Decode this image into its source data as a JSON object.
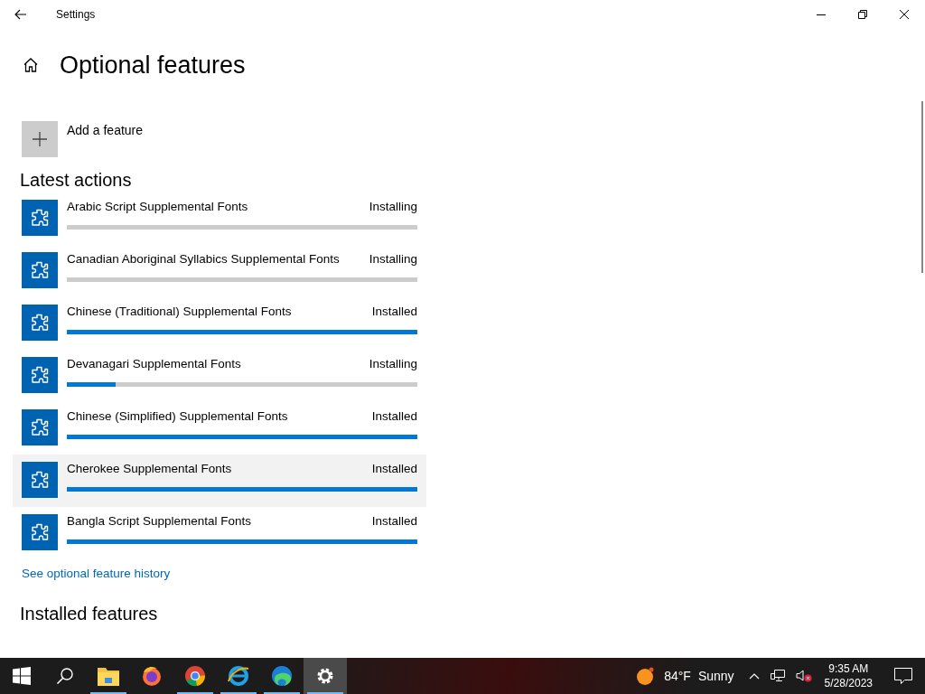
{
  "window": {
    "title": "Settings"
  },
  "page": {
    "title": "Optional features"
  },
  "add_feature": {
    "label": "Add a feature"
  },
  "latest_actions": {
    "heading": "Latest actions",
    "items": [
      {
        "name": "Arabic Script Supplemental Fonts",
        "status": "Installing",
        "level": 0,
        "highlighted": false
      },
      {
        "name": "Canadian Aboriginal Syllabics Supplemental Fonts",
        "status": "Installing",
        "level": 0,
        "highlighted": false
      },
      {
        "name": "Chinese (Traditional) Supplemental Fonts",
        "status": "Installed",
        "level": 1,
        "highlighted": false
      },
      {
        "name": "Devanagari Supplemental Fonts",
        "status": "Installing",
        "level": 0.14,
        "highlighted": false
      },
      {
        "name": "Chinese (Simplified) Supplemental Fonts",
        "status": "Installed",
        "level": 1,
        "highlighted": false
      },
      {
        "name": "Cherokee Supplemental Fonts",
        "status": "Installed",
        "level": 1,
        "highlighted": true
      },
      {
        "name": "Bangla Script Supplemental Fonts",
        "status": "Installed",
        "level": 1,
        "highlighted": false
      }
    ]
  },
  "history_link": "See optional feature history",
  "installed_heading": "Installed features",
  "taskbar": {
    "apps": [
      {
        "kind": "explorer",
        "running": true,
        "active": false
      },
      {
        "kind": "firefox",
        "running": false,
        "active": false
      },
      {
        "kind": "chrome",
        "running": true,
        "active": false
      },
      {
        "kind": "ie",
        "running": true,
        "active": false
      },
      {
        "kind": "edge",
        "running": true,
        "active": false
      },
      {
        "kind": "settings",
        "running": true,
        "active": true
      }
    ],
    "weather": {
      "temperature": "84°F",
      "condition": "Sunny"
    },
    "time": "9:35 AM",
    "date": "5/28/2023"
  }
}
